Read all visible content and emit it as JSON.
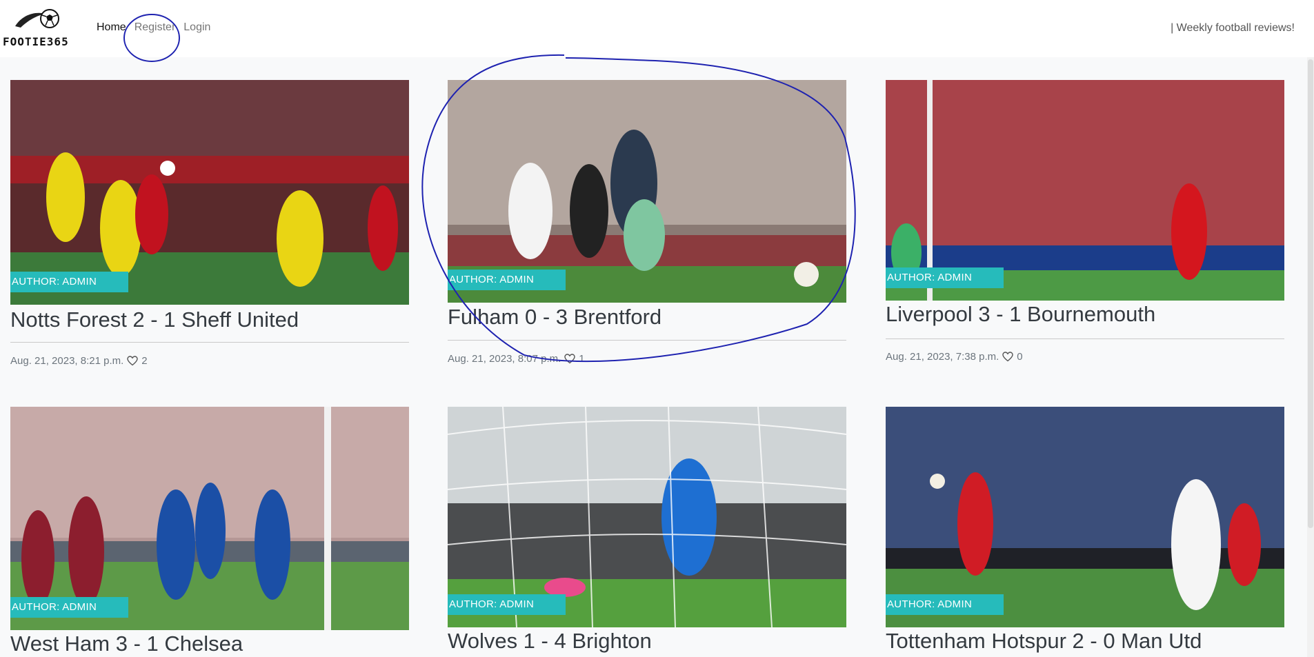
{
  "nav": {
    "brand_label": "FOOTIE365",
    "links": [
      "Home",
      "Register",
      "Login"
    ],
    "tagline": "| Weekly football reviews!"
  },
  "posts": [
    {
      "title": "Notts Forest 2 - 1 Sheff United",
      "author": "AUTHOR: ADMIN",
      "date": "Aug. 21, 2023, 8:21 p.m.",
      "likes": "2"
    },
    {
      "title": "Fulham 0 - 3 Brentford",
      "author": "AUTHOR: ADMIN",
      "date": "Aug. 21, 2023, 8:07 p.m.",
      "likes": "1"
    },
    {
      "title": "Liverpool 3 - 1 Bournemouth",
      "author": "AUTHOR: ADMIN",
      "date": "Aug. 21, 2023, 7:38 p.m.",
      "likes": "0"
    },
    {
      "title": "West Ham 3 - 1 Chelsea",
      "author": "AUTHOR: ADMIN"
    },
    {
      "title": "Wolves 1 - 4 Brighton",
      "author": "AUTHOR: ADMIN"
    },
    {
      "title": "Tottenham Hotspur 2 - 0 Man Utd",
      "author": "AUTHOR: ADMIN"
    }
  ],
  "colors": {
    "accent_badge": "#26bbbb",
    "annotation_ink": "#1e22b0"
  }
}
